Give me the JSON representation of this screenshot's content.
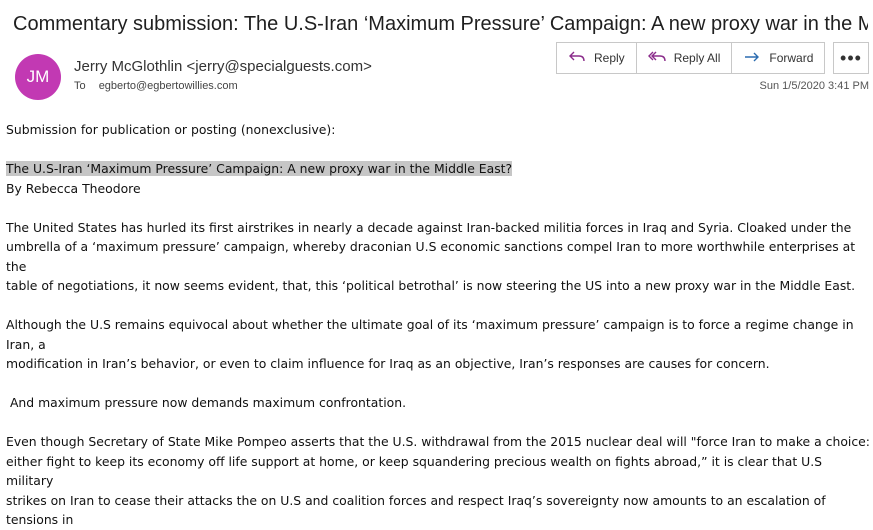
{
  "header": {
    "subject": "Commentary submission: The U.S-Iran ‘Maximum Pressure’ Campaign: A new proxy war in the Mi...",
    "avatar_initials": "JM",
    "avatar_color": "#c239b3",
    "sender": "Jerry McGlothlin <jerry@specialguests.com>",
    "to_label": "To",
    "to_address": "egberto@egbertowillies.com",
    "datetime": "Sun 1/5/2020 3:41 PM"
  },
  "actions": {
    "reply": "Reply",
    "reply_all": "Reply All",
    "forward": "Forward",
    "more": "•••"
  },
  "body": {
    "intro": "Submission for publication or posting (nonexclusive):",
    "title": "The U.S-Iran ‘Maximum Pressure’ Campaign: A new proxy war in the Middle East?",
    "byline": "By Rebecca Theodore",
    "p1_l1": "The United States has hurled its first airstrikes in nearly a decade against Iran-backed militia forces in Iraq and Syria.  Cloaked under the",
    "p1_l2": "umbrella of a ‘maximum pressure’ campaign, whereby draconian U.S economic sanctions compel Iran to more worthwhile enterprises at the",
    "p1_l3": "table of negotiations, it now seems evident, that, this ‘political betrothal’ is now steering the US into a new proxy war in the Middle East.",
    "p2_l1": "Although the   U.S remains equivocal about whether the ultimate goal of its ‘maximum pressure’ campaign is to force a regime change in Iran, a",
    "p2_l2": "modification in Iran’s behavior, or even to claim influence for Iraq as an objective, Iran’s responses are causes for concern.",
    "p3": " And maximum pressure now demands maximum confrontation.",
    "p4_l1": "Even though Secretary of State Mike Pompeo asserts that the U.S. withdrawal from the 2015 nuclear deal will \"force Iran to make a choice:",
    "p4_l2": "either fight to keep its economy off life support at home, or keep squandering precious wealth on fights abroad,”  it is clear that U.S  military",
    "p4_l3": "strikes on Iran to cease their attacks the on U.S and coalition forces and respect   Iraq’s sovereignty now amounts to an escalation of tensions in"
  }
}
